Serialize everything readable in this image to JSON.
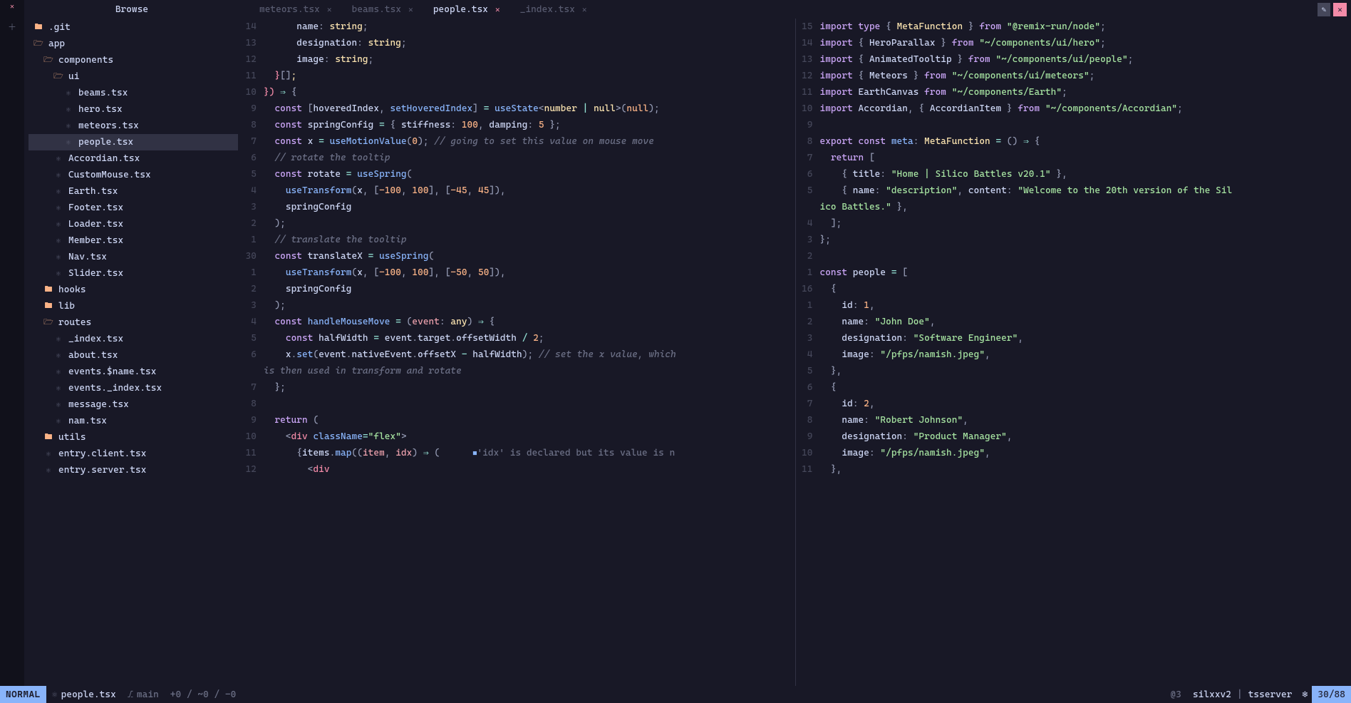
{
  "sidebar": {
    "title": "Browse",
    "tree": [
      {
        "l": 0,
        "icon": "folder",
        "name": ".git"
      },
      {
        "l": 0,
        "icon": "folder-open",
        "name": "app"
      },
      {
        "l": 1,
        "icon": "folder-open",
        "name": "components"
      },
      {
        "l": 2,
        "icon": "folder-open",
        "name": "ui"
      },
      {
        "l": 3,
        "icon": "react",
        "name": "beams.tsx"
      },
      {
        "l": 3,
        "icon": "react",
        "name": "hero.tsx"
      },
      {
        "l": 3,
        "icon": "react",
        "name": "meteors.tsx"
      },
      {
        "l": 3,
        "icon": "react",
        "name": "people.tsx",
        "selected": true
      },
      {
        "l": 2,
        "icon": "react",
        "name": "Accordian.tsx"
      },
      {
        "l": 2,
        "icon": "react",
        "name": "CustomMouse.tsx"
      },
      {
        "l": 2,
        "icon": "react",
        "name": "Earth.tsx"
      },
      {
        "l": 2,
        "icon": "react",
        "name": "Footer.tsx"
      },
      {
        "l": 2,
        "icon": "react",
        "name": "Loader.tsx"
      },
      {
        "l": 2,
        "icon": "react",
        "name": "Member.tsx"
      },
      {
        "l": 2,
        "icon": "react",
        "name": "Nav.tsx"
      },
      {
        "l": 2,
        "icon": "react",
        "name": "Slider.tsx"
      },
      {
        "l": 1,
        "icon": "folder",
        "name": "hooks"
      },
      {
        "l": 1,
        "icon": "folder",
        "name": "lib"
      },
      {
        "l": 1,
        "icon": "folder-open",
        "name": "routes"
      },
      {
        "l": 2,
        "icon": "react",
        "name": "_index.tsx"
      },
      {
        "l": 2,
        "icon": "react",
        "name": "about.tsx"
      },
      {
        "l": 2,
        "icon": "react",
        "name": "events.$name.tsx"
      },
      {
        "l": 2,
        "icon": "react",
        "name": "events._index.tsx"
      },
      {
        "l": 2,
        "icon": "react",
        "name": "message.tsx"
      },
      {
        "l": 2,
        "icon": "react",
        "name": "nam.tsx"
      },
      {
        "l": 1,
        "icon": "folder",
        "name": "utils"
      },
      {
        "l": 1,
        "icon": "react",
        "name": "entry.client.tsx"
      },
      {
        "l": 1,
        "icon": "react",
        "name": "entry.server.tsx"
      }
    ]
  },
  "tabs": [
    {
      "name": "meteors.tsx",
      "active": false
    },
    {
      "name": "beams.tsx",
      "active": false
    },
    {
      "name": "people.tsx",
      "active": true
    },
    {
      "name": "_index.tsx",
      "active": false
    }
  ],
  "leftPane": {
    "lines": [
      {
        "g": "14",
        "h": "      name<span class='punc'>:</span> <span class='type'>string</span><span class='punc'>;</span>"
      },
      {
        "g": "13",
        "h": "      designation<span class='punc'>:</span> <span class='type'>string</span><span class='punc'>;</span>"
      },
      {
        "g": "12",
        "h": "      image<span class='punc'>:</span> <span class='type'>string</span><span class='punc'>;</span>"
      },
      {
        "g": "11",
        "h": "  <span class='red'>}</span><span class='punc'>[]</span><span class='type'>;</span>"
      },
      {
        "g": "10",
        "h": "<span class='red'>})</span> <span class='op'>⇒</span> <span class='punc'>{</span>"
      },
      {
        "g": "9",
        "h": "  <span class='kw'>const</span> <span class='punc'>[</span>hoveredIndex<span class='punc'>,</span> <span class='fn'>setHoveredIndex</span><span class='punc'>]</span> <span class='op'>=</span> <span class='fn'>useState</span><span class='punc'>&lt;</span><span class='type'>number</span> <span class='op'>|</span> <span class='type'>null</span><span class='punc'>&gt;(</span><span class='num'>null</span><span class='punc'>);</span>"
      },
      {
        "g": "8",
        "h": "  <span class='kw'>const</span> springConfig <span class='op'>=</span> <span class='punc'>{</span> stiffness<span class='punc'>:</span> <span class='num'>100</span><span class='punc'>,</span> damping<span class='punc'>:</span> <span class='num'>5</span> <span class='punc'>};</span>"
      },
      {
        "g": "7",
        "h": "  <span class='kw'>const</span> x <span class='op'>=</span> <span class='fn'>useMotionValue</span><span class='punc'>(</span><span class='num'>0</span><span class='punc'>);</span> <span class='comment'>// going to set this value on mouse move</span>"
      },
      {
        "g": "6",
        "h": "  <span class='comment'>// rotate the tooltip</span>"
      },
      {
        "g": "5",
        "h": "  <span class='kw'>const</span> rotate <span class='op'>=</span> <span class='fn'>useSpring</span><span class='punc'>(</span>"
      },
      {
        "g": "4",
        "h": "    <span class='fn'>useTransform</span><span class='punc'>(</span>x<span class='punc'>,</span> <span class='punc'>[</span><span class='num'>-100</span><span class='punc'>,</span> <span class='num'>100</span><span class='punc'>],</span> <span class='punc'>[</span><span class='num'>-45</span><span class='punc'>,</span> <span class='num'>45</span><span class='punc'>]),</span>"
      },
      {
        "g": "3",
        "h": "    springConfig"
      },
      {
        "g": "2",
        "h": "  <span class='punc'>);</span>"
      },
      {
        "g": "1",
        "h": "  <span class='comment'>// translate the tooltip</span>"
      },
      {
        "g": "30",
        "abs": true,
        "h": "  <span class='kw'>const</span> translateX <span class='op'>=</span> <span class='fn'>useSpring</span><span class='punc'>(</span>"
      },
      {
        "g": "1",
        "h": "    <span class='fn'>useTransform</span><span class='punc'>(</span>x<span class='punc'>,</span> <span class='punc'>[</span><span class='num'>-100</span><span class='punc'>,</span> <span class='num'>100</span><span class='punc'>],</span> <span class='punc'>[</span><span class='num'>-50</span><span class='punc'>,</span> <span class='num'>50</span><span class='punc'>]),</span>"
      },
      {
        "g": "2",
        "h": "    springConfig"
      },
      {
        "g": "3",
        "h": "  <span class='punc'>);</span>"
      },
      {
        "g": "4",
        "h": "  <span class='kw'>const</span> <span class='fn'>handleMouseMove</span> <span class='op'>=</span> <span class='punc'>(</span><span class='param'>event</span><span class='punc'>:</span> <span class='type'>any</span><span class='punc'>)</span> <span class='op'>⇒</span> <span class='punc'>{</span>"
      },
      {
        "g": "5",
        "h": "    <span class='kw'>const</span> halfWidth <span class='op'>=</span> event<span class='punc'>.</span>target<span class='punc'>.</span>offsetWidth <span class='op'>/</span> <span class='num'>2</span><span class='punc'>;</span>"
      },
      {
        "g": "6",
        "h": "    x<span class='punc'>.</span><span class='fn'>set</span><span class='punc'>(</span>event<span class='punc'>.</span>nativeEvent<span class='punc'>.</span>offsetX <span class='op'>-</span> halfWidth<span class='punc'>);</span> <span class='comment'>// set the x value, which</span>"
      },
      {
        "g": "",
        "h": "<span class='comment'>is then used in transform and rotate</span>"
      },
      {
        "g": "7",
        "h": "  <span class='punc'>};</span>"
      },
      {
        "g": "8",
        "h": ""
      },
      {
        "g": "9",
        "h": "  <span class='kw'>return</span> <span class='punc'>(</span>"
      },
      {
        "g": "10",
        "h": "    <span class='punc'>&lt;</span><span class='red'>div</span> <span class='fn'>className</span><span class='op'>=</span><span class='str'>\"flex\"</span><span class='punc'>&gt;</span>"
      },
      {
        "g": "11",
        "h": "      <span class='punc'>{</span>items<span class='punc'>.</span><span class='fn'>map</span><span class='punc'>((</span><span class='param'>item</span><span class='punc'>,</span> <span class='param'>idx</span><span class='punc'>)</span> <span class='op'>⇒</span> <span class='punc'>(</span>      <span class='sq'>■</span><span class='hintbox'>'idx' is declared but its value is n</span>"
      },
      {
        "g": "12",
        "h": "        <span class='punc'>&lt;</span><span class='red'>div</span>"
      }
    ]
  },
  "rightPane": {
    "lines": [
      {
        "g": "15",
        "h": "<span class='kw'>import</span> <span class='kw'>type</span> <span class='punc'>{</span> <span class='type'>MetaFunction</span> <span class='punc'>}</span> <span class='kw'>from</span> <span class='str'>\"@remix-run/node\"</span><span class='punc'>;</span>"
      },
      {
        "g": "14",
        "h": "<span class='kw'>import</span> <span class='punc'>{</span> HeroParallax <span class='punc'>}</span> <span class='kw'>from</span> <span class='str'>\"~/components/ui/hero\"</span><span class='punc'>;</span>"
      },
      {
        "g": "13",
        "h": "<span class='kw'>import</span> <span class='punc'>{</span> AnimatedTooltip <span class='punc'>}</span> <span class='kw'>from</span> <span class='str'>\"~/components/ui/people\"</span><span class='punc'>;</span>"
      },
      {
        "g": "12",
        "h": "<span class='kw'>import</span> <span class='punc'>{</span> Meteors <span class='punc'>}</span> <span class='kw'>from</span> <span class='str'>\"~/components/ui/meteors\"</span><span class='punc'>;</span>"
      },
      {
        "g": "11",
        "h": "<span class='kw'>import</span> EarthCanvas <span class='kw'>from</span> <span class='str'>\"~/components/Earth\"</span><span class='punc'>;</span>"
      },
      {
        "g": "10",
        "h": "<span class='kw'>import</span> Accordian<span class='punc'>,</span> <span class='punc'>{</span> AccordianItem <span class='punc'>}</span> <span class='kw'>from</span> <span class='str'>\"~/components/Accordian\"</span><span class='punc'>;</span>"
      },
      {
        "g": "9",
        "h": ""
      },
      {
        "g": "8",
        "h": "<span class='kw'>export</span> <span class='kw'>const</span> <span class='fn'>meta</span><span class='punc'>:</span> <span class='type'>MetaFunction</span> <span class='op'>=</span> <span class='punc'>()</span> <span class='op'>⇒</span> <span class='punc'>{</span>"
      },
      {
        "g": "7",
        "h": "  <span class='kw'>return</span> <span class='punc'>[</span>"
      },
      {
        "g": "6",
        "h": "    <span class='punc'>{</span> title<span class='punc'>:</span> <span class='str'>\"Home | Silico Battles v20.1\"</span> <span class='punc'>},</span>"
      },
      {
        "g": "5",
        "h": "    <span class='punc'>{</span> name<span class='punc'>:</span> <span class='str'>\"description\"</span><span class='punc'>,</span> content<span class='punc'>:</span> <span class='str'>\"Welcome to the 20th version of the Sil</span>"
      },
      {
        "g": "",
        "h": "<span class='str'>ico Battles.\"</span> <span class='punc'>},</span>"
      },
      {
        "g": "4",
        "h": "  <span class='punc'>];</span>"
      },
      {
        "g": "3",
        "h": "<span class='punc'>};</span>"
      },
      {
        "g": "2",
        "h": ""
      },
      {
        "g": "1",
        "h": "<span class='kw'>const</span> people <span class='op'>=</span> <span class='punc'>[</span>"
      },
      {
        "g": "16",
        "abs": true,
        "h": "  <span class='punc'>{</span>"
      },
      {
        "g": "1",
        "h": "    id<span class='punc'>:</span> <span class='num'>1</span><span class='punc'>,</span>"
      },
      {
        "g": "2",
        "h": "    name<span class='punc'>:</span> <span class='str'>\"John Doe\"</span><span class='punc'>,</span>"
      },
      {
        "g": "3",
        "h": "    designation<span class='punc'>:</span> <span class='str'>\"Software Engineer\"</span><span class='punc'>,</span>"
      },
      {
        "g": "4",
        "h": "    image<span class='punc'>:</span> <span class='str'>\"/pfps/namish.jpeg\"</span><span class='punc'>,</span>"
      },
      {
        "g": "5",
        "h": "  <span class='punc'>},</span>"
      },
      {
        "g": "6",
        "h": "  <span class='punc'>{</span>"
      },
      {
        "g": "7",
        "h": "    id<span class='punc'>:</span> <span class='num'>2</span><span class='punc'>,</span>"
      },
      {
        "g": "8",
        "h": "    name<span class='punc'>:</span> <span class='str'>\"Robert Johnson\"</span><span class='punc'>,</span>"
      },
      {
        "g": "9",
        "h": "    designation<span class='punc'>:</span> <span class='str'>\"Product Manager\"</span><span class='punc'>,</span>"
      },
      {
        "g": "10",
        "h": "    image<span class='punc'>:</span> <span class='str'>\"/pfps/namish.jpeg\"</span><span class='punc'>,</span>"
      },
      {
        "g": "11",
        "h": "  <span class='punc'>},</span>"
      }
    ]
  },
  "statusbar": {
    "mode": "NORMAL",
    "file": "people.tsx",
    "branch": "main",
    "diff": "+0 / ~0 / -0",
    "diag": "@3",
    "user": "silxxv2",
    "lsp": "tsserver",
    "pos": "30/88"
  }
}
